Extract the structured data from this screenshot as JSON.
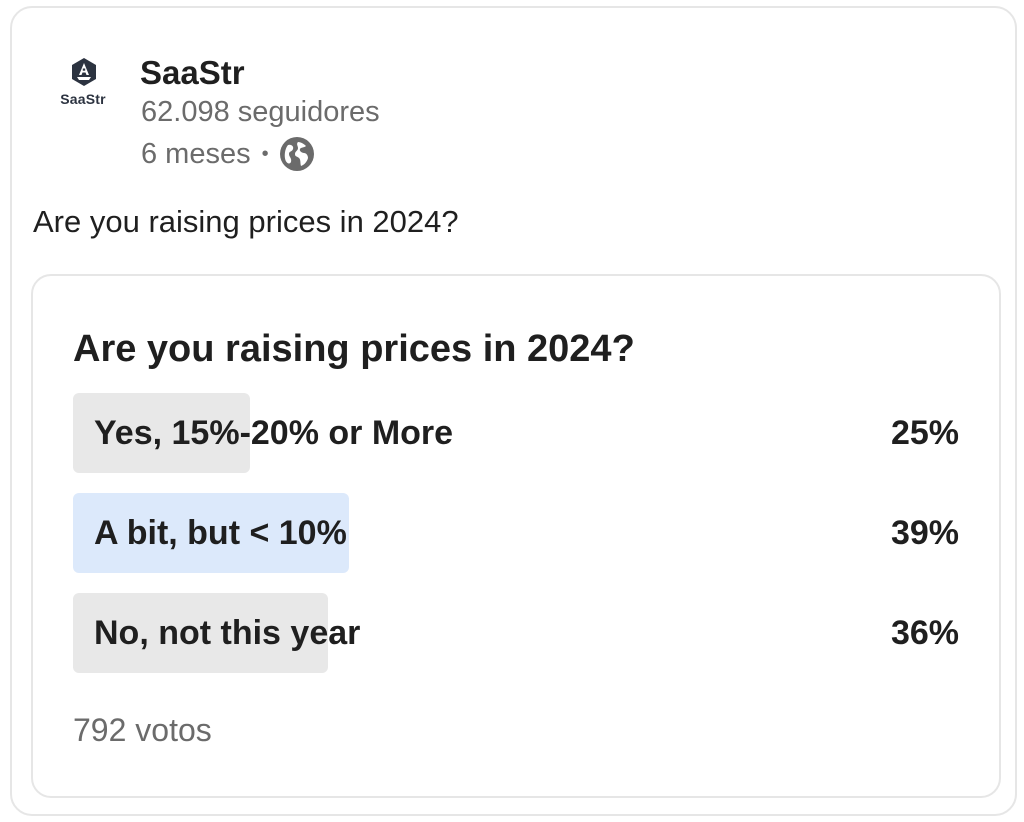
{
  "author": {
    "logo_text": "SaaStr",
    "name": "SaaStr",
    "followers": "62.098 seguidores",
    "time": "6 meses",
    "separator": "•",
    "visibility_icon": "globe-icon"
  },
  "post": {
    "text": "Are you raising prices in 2024?"
  },
  "poll": {
    "question": "Are you raising prices in 2024?",
    "options": [
      {
        "label": "Yes, 15%-20% or More",
        "percent": "25%",
        "share": 0.25,
        "selected": false
      },
      {
        "label": "A bit, but < 10%",
        "percent": "39%",
        "share": 0.39,
        "selected": true
      },
      {
        "label": "No, not this year",
        "percent": "36%",
        "share": 0.36,
        "selected": false
      }
    ],
    "votes": "792 votos"
  },
  "colors": {
    "option_fill": "#e8e8e8",
    "option_fill_selected": "#dce9fb",
    "secondary_text": "#6b6b6b",
    "logo_badge": "#2c3340"
  }
}
